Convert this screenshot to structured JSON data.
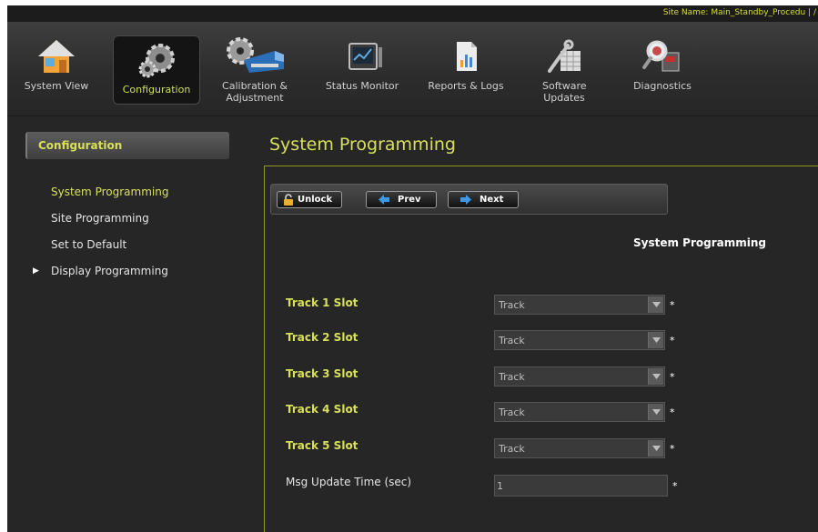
{
  "site_name": "Site Name: Main_Standby_Procedu | /",
  "nav": [
    {
      "label": "System View",
      "icon": "home-icon"
    },
    {
      "label": "Configuration",
      "icon": "gears-icon"
    },
    {
      "label": "Calibration & Adjustment",
      "icon": "train-gear-icon"
    },
    {
      "label": "Status Monitor",
      "icon": "monitor-icon"
    },
    {
      "label": "Reports & Logs",
      "icon": "report-icon"
    },
    {
      "label": "Software Updates",
      "icon": "software-icon"
    },
    {
      "label": "Diagnostics",
      "icon": "magnifier-icon"
    }
  ],
  "left_panel": {
    "header": "Configuration",
    "items": [
      {
        "label": "System Programming",
        "active": true
      },
      {
        "label": "Site Programming"
      },
      {
        "label": "Set to Default"
      },
      {
        "label": "Display Programming",
        "has_arrow": true
      }
    ]
  },
  "page_title": "System Programming",
  "toolbar": {
    "unlock": "Unlock",
    "prev": "Prev",
    "next": "Next"
  },
  "section_title": "System Programming",
  "fields": [
    {
      "label": "Track 1 Slot",
      "value": "Track",
      "required": "*"
    },
    {
      "label": "Track 2 Slot",
      "value": "Track",
      "required": "*"
    },
    {
      "label": "Track 3 Slot",
      "value": "Track",
      "required": "*"
    },
    {
      "label": "Track 4 Slot",
      "value": "Track",
      "required": "*"
    },
    {
      "label": "Track 5 Slot",
      "value": "Track",
      "required": "*"
    }
  ],
  "msg_update": {
    "label": "Msg Update Time (sec)",
    "value": "1",
    "required": "*"
  },
  "colors": {
    "accent": "#d8e05a",
    "background": "#262626",
    "border_accent": "#8f9a1f"
  }
}
